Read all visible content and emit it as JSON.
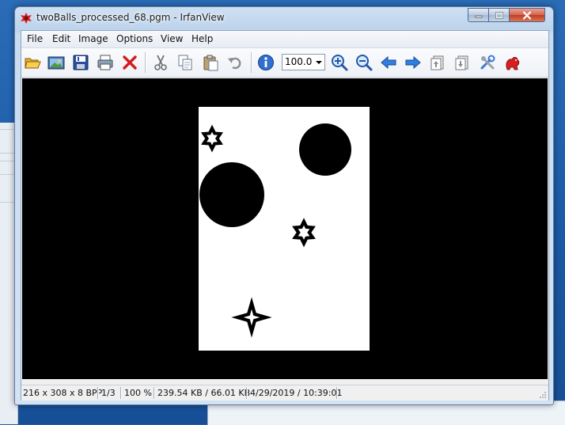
{
  "window": {
    "title": "twoBalls_processed_68.pgm - IrfanView"
  },
  "menu": {
    "items": [
      "File",
      "Edit",
      "Image",
      "Options",
      "View",
      "Help"
    ]
  },
  "toolbar": {
    "zoom_value": "100.0",
    "icons": [
      "open-icon",
      "slideshow-icon",
      "save-icon",
      "print-icon",
      "delete-icon",
      "cut-icon",
      "copy-icon",
      "paste-icon",
      "undo-icon",
      "info-icon",
      "zoom-in-icon",
      "zoom-out-icon",
      "previous-icon",
      "next-icon",
      "first-page-icon",
      "last-page-icon",
      "settings-icon",
      "irfanview-logo-icon"
    ]
  },
  "status": {
    "dimensions": "216 x 308 x 8 BPP",
    "page": "1/3",
    "zoom": "100 %",
    "size": "239.54 KB / 66.01 KB",
    "datetime": "4/29/2019 / 10:39:01"
  },
  "colors": {
    "viewport_bg": "#000000",
    "image_bg": "#ffffff",
    "titlebar": "#bcd3ec",
    "close_button": "#c23c20"
  }
}
